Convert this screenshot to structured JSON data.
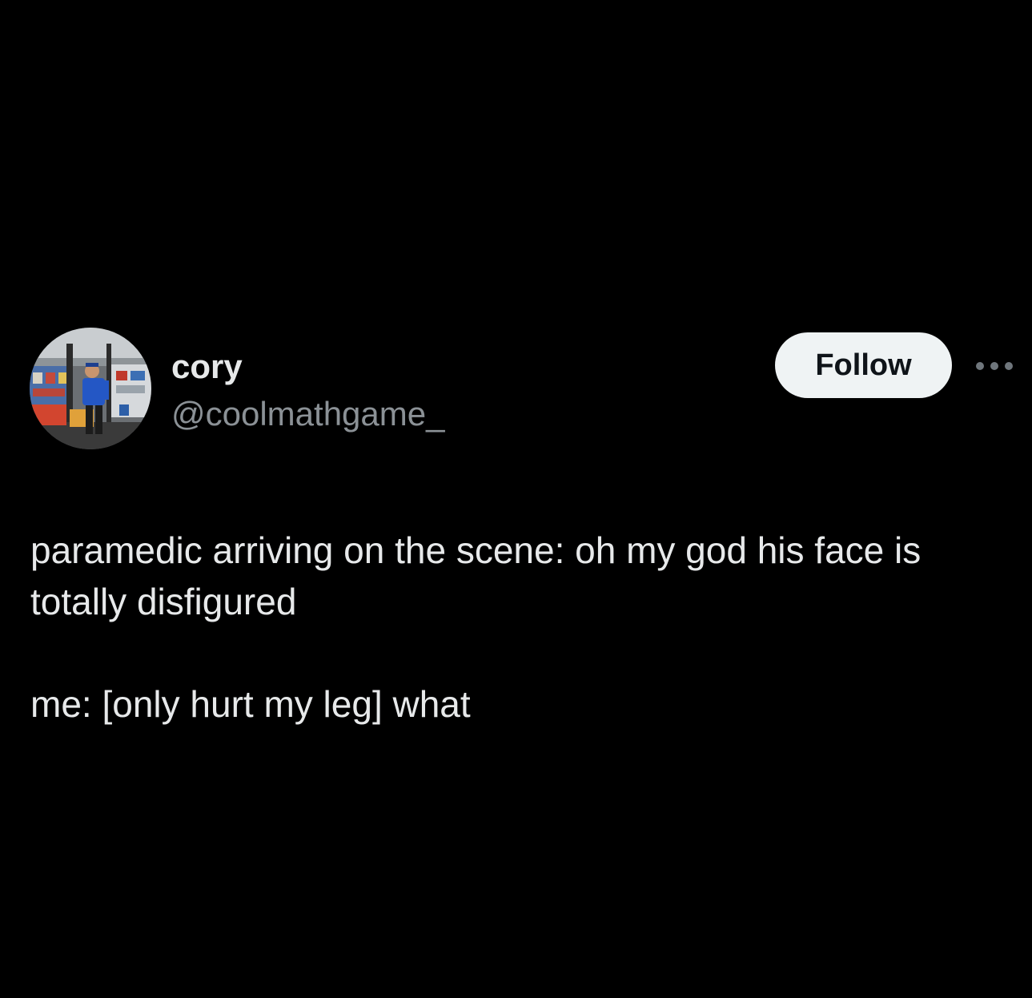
{
  "author": {
    "display_name": "cory",
    "handle": "@coolmathgame_",
    "avatar_icon": "profile-photo"
  },
  "actions": {
    "follow_label": "Follow",
    "more_icon": "more-options-icon"
  },
  "tweet": {
    "paragraphs": [
      "paramedic arriving on the scene: oh my god his face is totally disfigured",
      "me: [only hurt my leg] what"
    ]
  },
  "colors": {
    "background": "#000000",
    "text_primary": "#e7e9ea",
    "text_secondary": "#8b9196",
    "follow_bg": "#eff3f4",
    "follow_text": "#0f1419"
  }
}
